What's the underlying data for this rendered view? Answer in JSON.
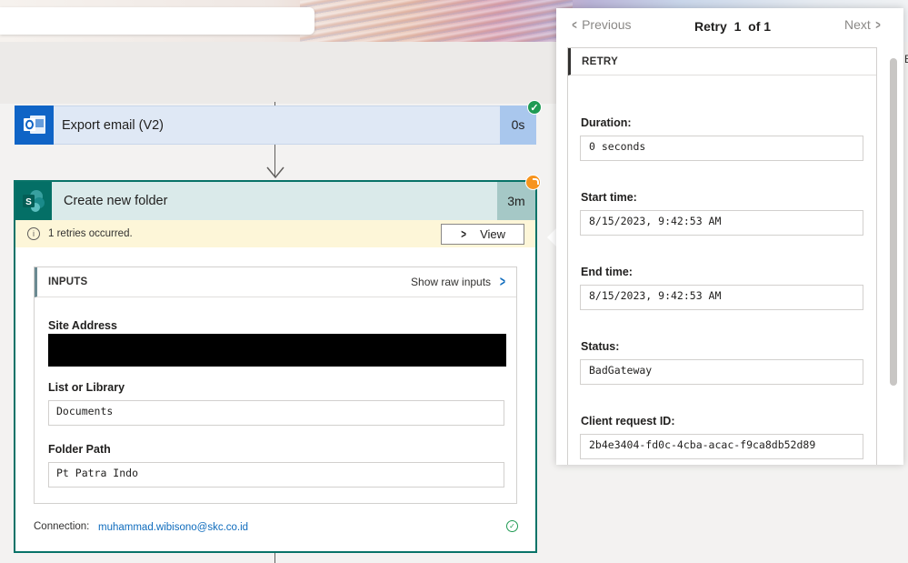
{
  "flow": {
    "export_step": {
      "title": "Export email (V2)",
      "duration": "0s"
    },
    "folder_step": {
      "title": "Create new folder",
      "duration": "3m",
      "retry_notice": "1 retries occurred.",
      "view_label": "View",
      "inputs": {
        "header": "INPUTS",
        "raw_link": "Show raw inputs",
        "fields": [
          {
            "label": "Site Address",
            "value": ""
          },
          {
            "label": "List or Library",
            "value": "Documents"
          },
          {
            "label": "Folder Path",
            "value": "Pt Patra Indo"
          }
        ]
      },
      "connection_label": "Connection:",
      "connection_value": "muhammad.wibisono@skc.co.id"
    }
  },
  "retry_panel": {
    "prev_label": "Previous",
    "next_label": "Next",
    "counter_prefix": "Retry",
    "current": "1",
    "of_label": "of",
    "total": "1",
    "section_title": "RETRY",
    "details": [
      {
        "label": "Duration:",
        "value": "0 seconds"
      },
      {
        "label": "Start time:",
        "value": "8/15/2023, 9:42:53 AM"
      },
      {
        "label": "End time:",
        "value": "8/15/2023, 9:42:53 AM"
      },
      {
        "label": "Status:",
        "value": "BadGateway"
      },
      {
        "label": "Client request ID:",
        "value": "2b4e3404-fd0c-4cba-acac-f9ca8db52d89"
      }
    ]
  },
  "edge_text": "E",
  "colors": {
    "outlook_blue": "#0f64c6",
    "sharepoint_teal": "#046f66",
    "success_green": "#1f9a53",
    "warning_orange": "#f7941d",
    "link_blue": "#0f6cbd"
  }
}
